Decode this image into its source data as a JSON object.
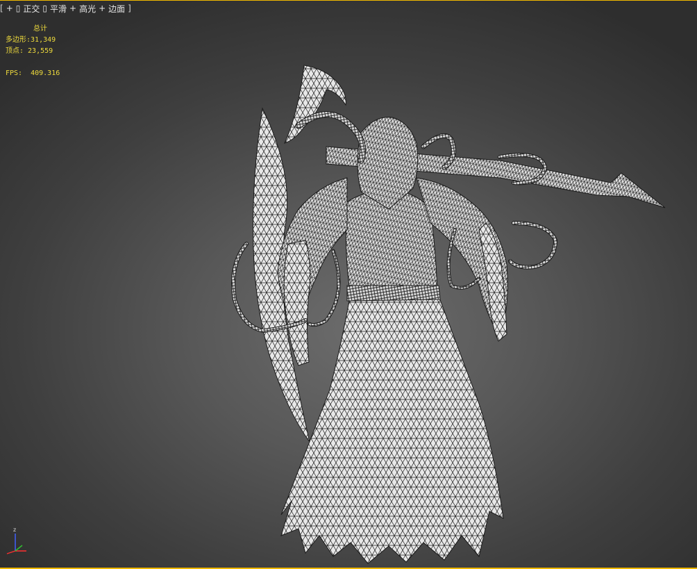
{
  "viewport": {
    "label_items": [
      {
        "text": "[",
        "kind": "bracket"
      },
      {
        "text": "+",
        "kind": "menu"
      },
      {
        "text": "▯",
        "kind": "menu"
      },
      {
        "text": "正交",
        "kind": "menu"
      },
      {
        "text": "▯",
        "kind": "menu"
      },
      {
        "text": "平滑",
        "kind": "menu"
      },
      {
        "text": "+",
        "kind": "menu"
      },
      {
        "text": "高光",
        "kind": "menu"
      },
      {
        "text": "+",
        "kind": "menu"
      },
      {
        "text": "边面",
        "kind": "menu"
      },
      {
        "text": "]",
        "kind": "bracket"
      }
    ],
    "border_color": "#f0b800"
  },
  "stats": {
    "title": "总计",
    "polygons_label": "多边形:",
    "polygons_value": "31,349",
    "vertices_label": "顶点:",
    "vertices_value": "23,559",
    "fps_label": "FPS:",
    "fps_value": "409.316",
    "text_color": "#f0dc3c"
  },
  "gizmo": {
    "z_label": "z",
    "x_color": "#ff3030",
    "y_color": "#30c030",
    "z_color": "#4060ff"
  },
  "model": {
    "wire_color": "#1a1a1a",
    "fill_color": "#e6e6e6",
    "icon": "reaper-wireframe-mesh"
  }
}
